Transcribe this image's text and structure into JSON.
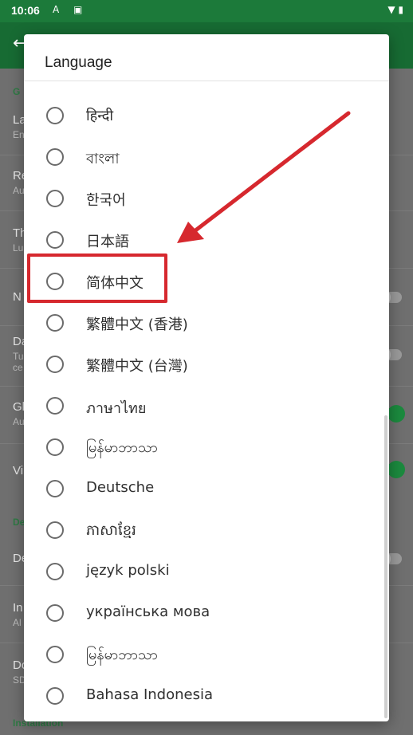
{
  "status_bar": {
    "time": "10:06",
    "icons": [
      "font-icon",
      "notification-a-icon",
      "wifi-icon",
      "battery-icon"
    ]
  },
  "dialog": {
    "title": "Language",
    "options": [
      {
        "label": "हिन्दी",
        "selected": false
      },
      {
        "label": "বাংলা",
        "selected": false
      },
      {
        "label": "한국어",
        "selected": false
      },
      {
        "label": "日本語",
        "selected": false
      },
      {
        "label": "简体中文",
        "selected": false,
        "highlighted": true
      },
      {
        "label": "繁體中文 (香港)",
        "selected": false
      },
      {
        "label": "繁體中文 (台灣)",
        "selected": false
      },
      {
        "label": "ภาษาไทย",
        "selected": false
      },
      {
        "label": "မြန်မာဘာသာ",
        "selected": false
      },
      {
        "label": "Deutsche",
        "selected": false
      },
      {
        "label": "ភាសាខ្មែរ",
        "selected": false
      },
      {
        "label": "język polski",
        "selected": false
      },
      {
        "label": "українська мова",
        "selected": false
      },
      {
        "label": "မြန်မာဘာသာ",
        "selected": false
      },
      {
        "label": "Bahasa Indonesia",
        "selected": false
      }
    ]
  },
  "colors": {
    "app_bar": "#176b33",
    "accent": "#1b8a3e",
    "annotation": "#d6282e"
  }
}
